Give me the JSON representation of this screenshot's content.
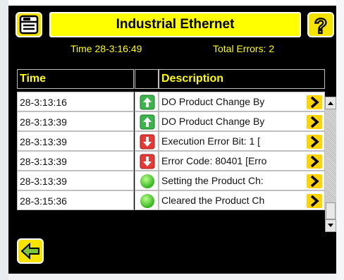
{
  "header": {
    "title": "Industrial Ethernet",
    "menu_icon": "menu-icon",
    "help_icon": "help-icon"
  },
  "status": {
    "time": "Time 28-3:16:49",
    "total_errors": "Total Errors: 2"
  },
  "table": {
    "columns": [
      "Time",
      "",
      "Description"
    ],
    "rows": [
      {
        "time": "28-3:13:16",
        "icon": "arrow-up-green-icon",
        "description": "DO Product Change By"
      },
      {
        "time": "28-3:13:39",
        "icon": "arrow-up-green-icon",
        "description": "DO Product Change By"
      },
      {
        "time": "28-3:13:39",
        "icon": "arrow-down-red-icon",
        "description": "Execution Error Bit: 1 ["
      },
      {
        "time": "28-3:13:39",
        "icon": "arrow-down-red-icon",
        "description": "Error Code: 80401 [Erro"
      },
      {
        "time": "28-3:13:39",
        "icon": "green-circle-icon",
        "description": "Setting the Product Ch:"
      },
      {
        "time": "28-3:15:36",
        "icon": "green-circle-icon",
        "description": "Cleared the Product Ch"
      }
    ]
  },
  "footer": {
    "back_icon": "back-arrow-icon"
  },
  "colors": {
    "background": "#000000",
    "accent": "#ffff00",
    "button": "#f5e400"
  }
}
